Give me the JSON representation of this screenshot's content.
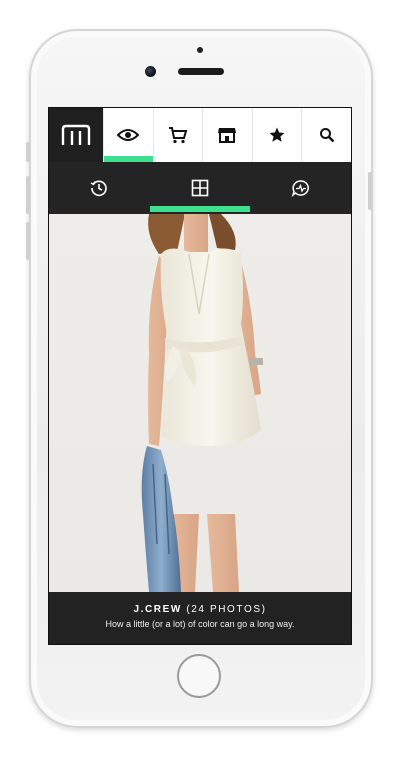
{
  "nav": {
    "logo_icon": "brand-logo-icon",
    "tabs": [
      {
        "icon": "eye-icon",
        "active": true
      },
      {
        "icon": "cart-icon",
        "active": false
      },
      {
        "icon": "store-icon",
        "active": false
      },
      {
        "icon": "star-icon",
        "active": false
      },
      {
        "icon": "search-icon",
        "active": false
      }
    ],
    "subtabs": [
      {
        "icon": "history-icon",
        "active": false
      },
      {
        "icon": "grid-icon",
        "active": true
      },
      {
        "icon": "activity-chat-icon",
        "active": false
      }
    ],
    "accent_color": "#3ce08f"
  },
  "photo": {
    "description_icon": "fashion-photo"
  },
  "caption": {
    "brand": "J.CREW",
    "count": "(24 PHOTOS)",
    "subtitle": "How a little (or a lot) of color can go a long way."
  }
}
